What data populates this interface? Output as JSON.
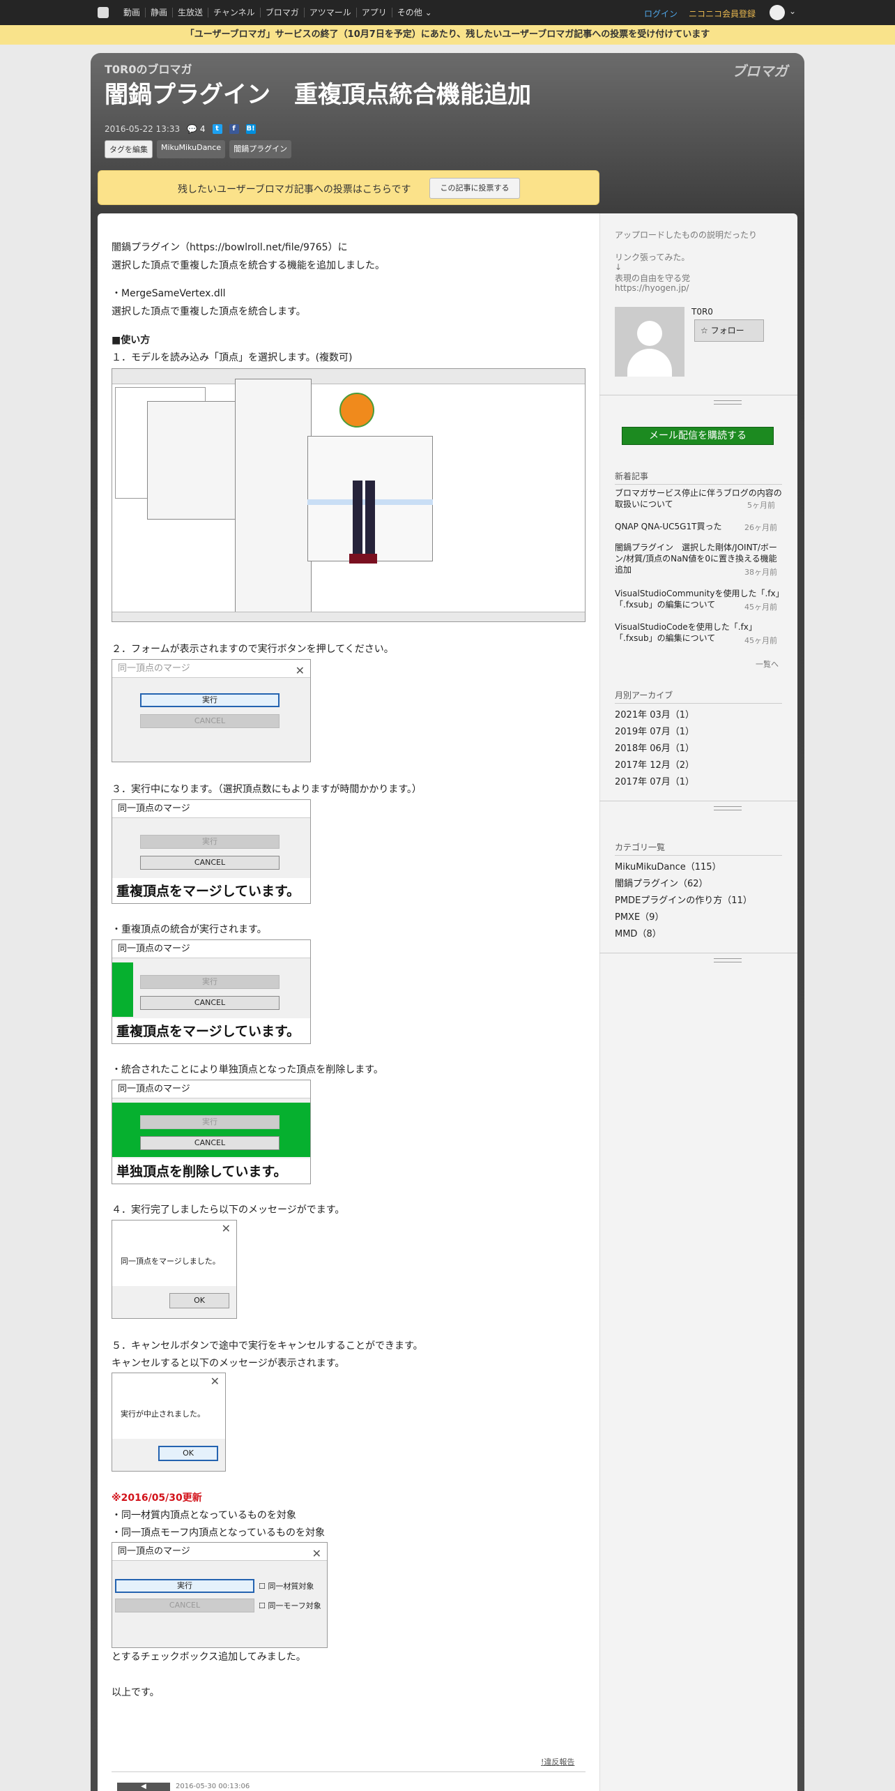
{
  "topbar": {
    "nav": [
      "動画",
      "静画",
      "生放送",
      "チャンネル",
      "ブロマガ",
      "アツマール",
      "アプリ",
      "その他"
    ],
    "login": "ログイン",
    "register": "ニコニコ会員登録"
  },
  "notice": "「ユーザーブロマガ」サービスの終了（10月7日を予定）にあたり、残したいユーザーブロマガ記事への投票を受け付けています",
  "blog": {
    "name": "T0R0のブロマガ",
    "brand": "ブロマガ"
  },
  "post": {
    "title": "闇鍋プラグイン　重複頂点統合機能追加",
    "date": "2016-05-22 13:33",
    "comments": "4",
    "edit_tags": "タグを編集",
    "tags": [
      "MikuMikuDance",
      "闇鍋プラグイン"
    ]
  },
  "vote": {
    "text": "残したいユーザーブロマガ記事への投票はこちらです",
    "button": "この記事に投票する"
  },
  "body": {
    "p1a": "闇鍋プラグイン（https://bowlroll.net/file/9765）に",
    "p1b": "選択した頂点で重複した頂点を統合する機能を追加しました。",
    "p2a": "・MergeSameVertex.dll",
    "p2b": "選択した頂点で重複した頂点を統合します。",
    "usage": "■使い方",
    "s1": "１．モデルを読み込み「頂点」を選択します。(複数可)",
    "s2": "２．フォームが表示されますので実行ボタンを押してください。",
    "s3": "３．実行中になります。（選択頂点数にもよりますが時間かかります。）",
    "s3b": "・重複頂点の統合が実行されます。",
    "s3c": "・統合されたことにより単独頂点となった頂点を削除します。",
    "s4": "４．実行完了しましたら以下のメッセージがでます。",
    "s5a": "５．キャンセルボタンで途中で実行をキャンセルすることができます。",
    "s5b": "キャンセルすると以下のメッセージが表示されます。",
    "update": "※2016/05/30更新",
    "u1": "・同一材質内頂点となっているものを対象",
    "u2": "・同一頂点モーフ内頂点となっているものを対象",
    "u3": "とするチェックボックス追加してみました。",
    "end": "以上です。",
    "report": "!違反報告",
    "nextdate": "2016-05-30 00:13:06"
  },
  "dialog": {
    "title": "同一頂点のマージ",
    "run": "実行",
    "cancel_dis": "CANCEL",
    "cancel": "CANCEL",
    "merging": "重複頂点をマージしています。",
    "deleting": "単独頂点を削除しています。",
    "done": "同一頂点をマージしました。",
    "ok": "OK",
    "aborted": "実行が中止されました。",
    "chk1": "同一材質対象",
    "chk2": "同一モーフ対象"
  },
  "side": {
    "desc1": "アップロードしたものの説明だったり",
    "desc2": "リンク張ってみた。",
    "desc3": "↓",
    "desc4": "表現の自由を守る党",
    "desc5": "https://hyogen.jp/",
    "user": "T0R0",
    "follow": "フォロー",
    "mail": "メール配信を購読する",
    "newh": "新着記事",
    "news": [
      {
        "t1": "ブロマガサービス停止に伴うブログの内容の",
        "t2": "取扱いについて",
        "age": "5ヶ月前"
      },
      {
        "t1": "QNAP QNA-UC5G1T買った",
        "t2": "",
        "age": "26ヶ月前"
      },
      {
        "t1": "闇鍋プラグイン　選択した剛体/JOINT/ボー",
        "t2": "ン/材質/頂点のNaN値を0に置き換える機能",
        "t3": "追加",
        "age": "38ヶ月前"
      },
      {
        "t1": "VisualStudioCommunityを使用した「.fx」",
        "t2": "「.fxsub」の編集について",
        "age": "45ヶ月前"
      },
      {
        "t1": "VisualStudioCodeを使用した「.fx」",
        "t2": "「.fxsub」の編集について",
        "age": "45ヶ月前"
      }
    ],
    "more": "一覧へ",
    "archh": "月別アーカイブ",
    "arch": [
      "2021年 03月（1）",
      "2019年 07月（1）",
      "2018年 06月（1）",
      "2017年 12月（2）",
      "2017年 07月（1）"
    ],
    "cath": "カテゴリ一覧",
    "cats": [
      "MikuMikuDance（115）",
      "闇鍋プラグイン（62）",
      "PMDEプラグインの作り方（11）",
      "PMXE（9）",
      "MMD（8）"
    ]
  }
}
